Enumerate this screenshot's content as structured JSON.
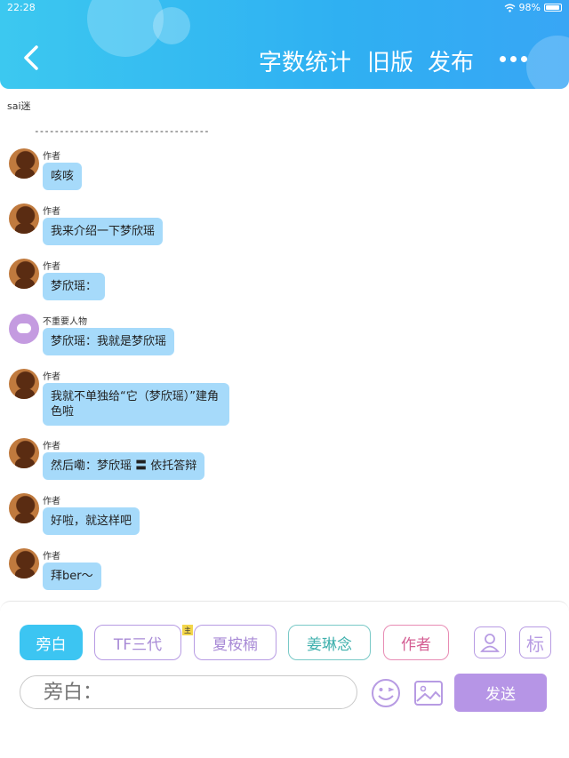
{
  "status_bar": {
    "time": "22:28",
    "battery": "98%"
  },
  "header": {
    "stats_label": "字数统计",
    "old_label": "旧版",
    "publish_label": "发布"
  },
  "story": {
    "title": "sai迷",
    "divider": "-----------------------------------"
  },
  "messages": [
    {
      "sender": "作者",
      "text": "咳咳"
    },
    {
      "sender": "作者",
      "text": "我来介绍一下梦欣瑶"
    },
    {
      "sender": "作者",
      "text": "梦欣瑶："
    },
    {
      "sender": "不重要人物",
      "text": "梦欣瑶：我就是梦欣瑶"
    },
    {
      "sender": "作者",
      "text": "我就不单独给“它（梦欣瑶）”建角色啦"
    },
    {
      "sender": "作者",
      "text": "然后嘞：梦欣瑶 〓 依托答辩"
    },
    {
      "sender": "作者",
      "text": "好啦，就这样吧"
    },
    {
      "sender": "作者",
      "text": "拜ber～"
    }
  ],
  "composer": {
    "roles": [
      "旁白",
      "TF三代",
      "夏桉楠",
      "姜琳念",
      "作者"
    ],
    "main_tag": "主",
    "tag_icon_label": "标",
    "input_placeholder": "旁白：",
    "send_label": "发送"
  },
  "colors": {
    "header_blue": "#2fb0f2",
    "bubble_blue": "#a6dafa",
    "send_purple": "#b695e6"
  },
  "icons": [
    "back-icon",
    "more-icon",
    "person-icon",
    "emoji-icon",
    "image-icon",
    "wifi-icon",
    "battery-icon"
  ]
}
